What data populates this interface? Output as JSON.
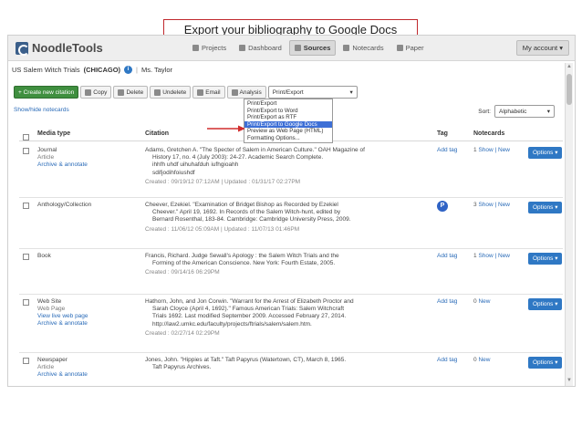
{
  "callout": "Export your bibliography to Google Docs",
  "header": {
    "brand": "NoodleTools",
    "tabs": [
      "Projects",
      "Dashboard",
      "Sources",
      "Notecards",
      "Paper"
    ],
    "active_tab": "Sources",
    "account": "My account"
  },
  "project": {
    "name": "US Salem Witch Trials",
    "style": "(CHICAGO)",
    "teacher": "Ms. Taylor"
  },
  "toolbar": {
    "new_citation": "+ Create new citation",
    "copy": "Copy",
    "delete": "Delete",
    "undelete": "Undelete",
    "email": "Email",
    "analysis": "Analysis",
    "export_value": "Print/Export"
  },
  "export_menu": [
    "Print/Export",
    "Print/Export to Word",
    "Print/Export as RTF",
    "Print/Export to Google Docs",
    "Preview as Web Page (HTML)",
    "Formatting Options..."
  ],
  "export_menu_highlighted": "Print/Export to Google Docs",
  "show_notecards": "Show/hide notecards",
  "sort": {
    "label": "Sort:",
    "value": "Alphabetic"
  },
  "columns": {
    "media": "Media type",
    "citation": "Citation",
    "tag": "Tag",
    "notecards": "Notecards"
  },
  "rows": [
    {
      "media": "Journal",
      "sub": "Article",
      "links": [
        "Archive & annotate"
      ],
      "citation": [
        "Adams, Gretchen A. \"The Specter of Salem in American Culture.\" OAH Magazine of",
        "History 17, no. 4 (July 2003): 24-27. Academic Search Complete.",
        "ihhfh uhdf uihuhafduh iufhgioahh",
        "sdifjodihfoiushdf"
      ],
      "meta": "Created : 09/19/12 07:12AM | Updated : 01/31/17 02:27PM",
      "tag": "Add tag",
      "notes_count": "1",
      "notes": "Show | New",
      "options": "Options ▾"
    },
    {
      "media": "Anthology/Collection",
      "sub": "",
      "links": [],
      "citation": [
        "Cheever, Ezekiel. \"Examination of Bridget Bishop as Recorded by Ezekiel",
        "Cheever.\" April 19, 1692. In Records of the Salem Witch-hunt, edited by",
        "Bernard Rosenthal, 183-84. Cambridge: Cambridge University Press, 2009."
      ],
      "meta": "Created : 11/06/12 05:09AM | Updated : 11/07/13 01:46PM",
      "tag": "P",
      "notes_count": "3",
      "notes": "Show | New",
      "options": "Options ▾"
    },
    {
      "media": "Book",
      "sub": "",
      "links": [],
      "citation": [
        "Francis, Richard. Judge Sewall's Apology : the Salem Witch Trials and the",
        "Forming of the American Conscience. New York: Fourth Estate, 2005."
      ],
      "meta": "Created : 09/14/16 06:29PM",
      "tag": "Add tag",
      "notes_count": "1",
      "notes": "Show | New",
      "options": "Options ▾"
    },
    {
      "media": "Web Site",
      "sub": "Web Page",
      "links": [
        "View live web page",
        "Archive & annotate"
      ],
      "citation": [
        "Hathorn, John, and Jon Corwin. \"Warrant for the Arrest of Elizabeth Proctor and",
        "Sarah Cloyce (April 4, 1692).\" Famous American Trials: Salem Witchcraft",
        "Trials 1692. Last modified September 2009. Accessed February 27, 2014.",
        "http://law2.umkc.edu/faculty/projects/ftrials/salem/salem.htm."
      ],
      "meta": "Created : 02/27/14 02:29PM",
      "tag": "Add tag",
      "notes_count": "0",
      "notes": "New",
      "options": "Options ▾"
    },
    {
      "media": "Newspaper",
      "sub": "Article",
      "links": [
        "Archive & annotate"
      ],
      "citation": [
        "Jones, John. \"Hippies at Taft.\" Taft Papyrus (Watertown, CT), March 8, 1965.",
        "Taft Papyrus Archives."
      ],
      "meta": "",
      "tag": "Add tag",
      "notes_count": "0",
      "notes": "New",
      "options": "Options ▾"
    }
  ],
  "colors": {
    "accent": "#2f78c4",
    "callout_border": "#c0282d",
    "highlight": "#3d6fd6",
    "new_button": "#3f8f3f"
  }
}
